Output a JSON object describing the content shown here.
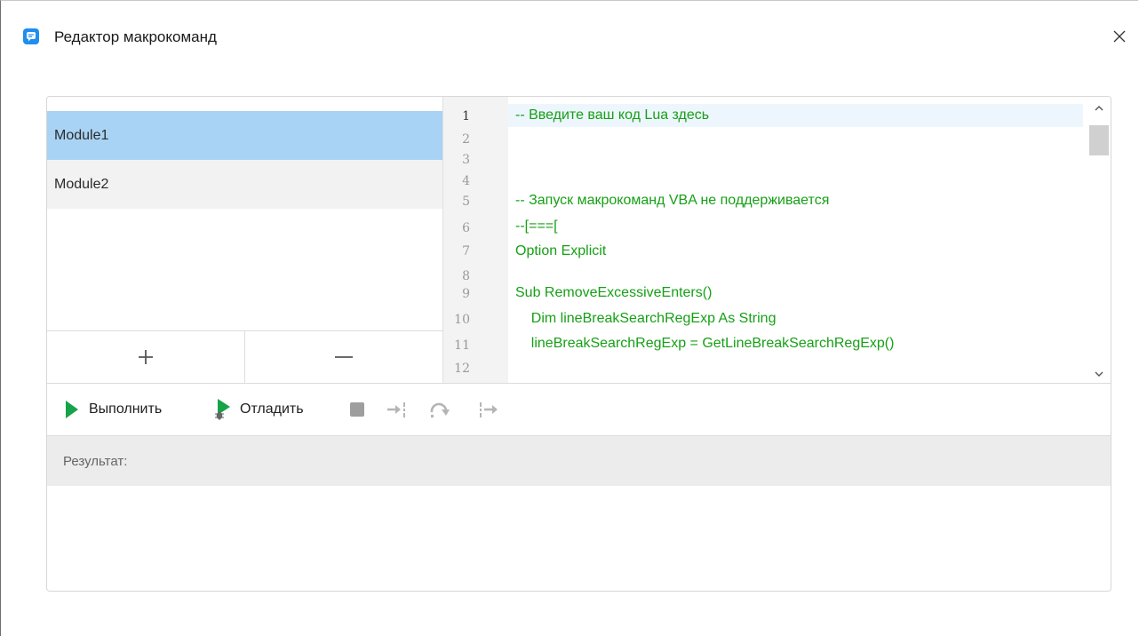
{
  "window": {
    "title": "Редактор макрокоманд",
    "close_label": "Close"
  },
  "modules": {
    "items": [
      {
        "label": "Module1",
        "selected": true
      },
      {
        "label": "Module2",
        "selected": false
      }
    ],
    "add_label": "+",
    "remove_label": "−"
  },
  "editor": {
    "current_line": 1,
    "line_numbers": [
      "1",
      "2",
      "3",
      "4",
      "5",
      "6",
      "7",
      "8",
      "9",
      "10",
      "11",
      "12"
    ],
    "code_lines": [
      {
        "line": 1,
        "text": "-- Введите ваш код Lua здесь"
      },
      {
        "line": 5,
        "text": "-- Запуск макрокоманд VBA не поддерживается"
      },
      {
        "line": 6,
        "text": "--[===["
      },
      {
        "line": 7,
        "text": "Option Explicit"
      },
      {
        "line": 9,
        "text": "Sub RemoveExcessiveEnters()"
      },
      {
        "line": 10,
        "text": "    Dim lineBreakSearchRegExp As String"
      },
      {
        "line": 11,
        "text": "    lineBreakSearchRegExp = GetLineBreakSearchRegExp()"
      }
    ],
    "code_color": "#16a016"
  },
  "toolbar": {
    "run_label": "Выполнить",
    "debug_label": "Отладить",
    "icons": [
      "play-icon",
      "debug-icon",
      "stop-icon",
      "step-into-icon",
      "step-over-icon",
      "step-out-icon"
    ]
  },
  "result": {
    "label": "Результат:",
    "output": ""
  },
  "colors": {
    "selected_module": "#a8d3f5",
    "play_green": "#16a34a",
    "accent_blue": "#1e8ef0"
  }
}
